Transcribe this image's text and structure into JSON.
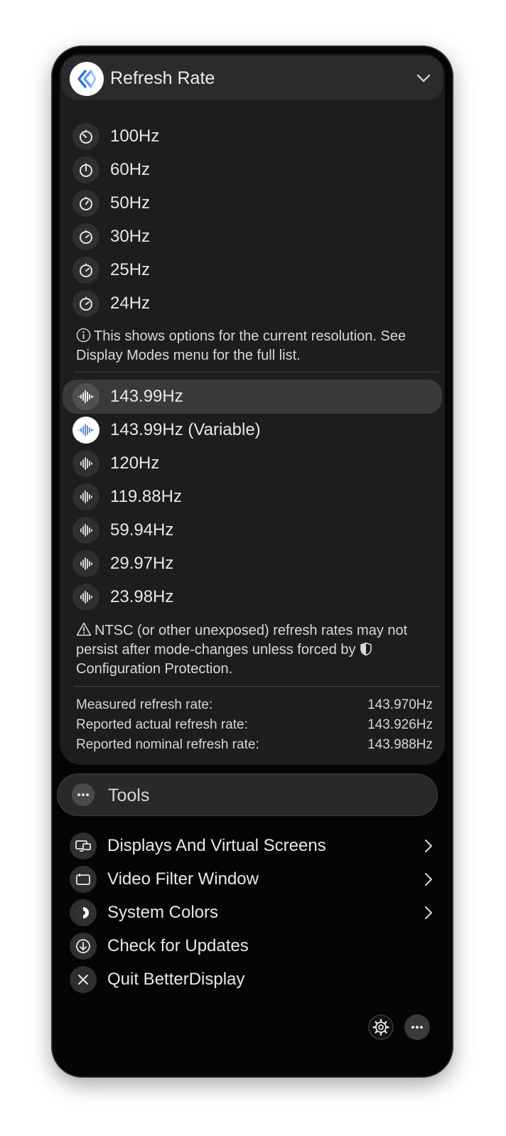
{
  "header": {
    "title": "Refresh Rate"
  },
  "rates_current": [
    {
      "label": "100Hz"
    },
    {
      "label": "60Hz"
    },
    {
      "label": "50Hz"
    },
    {
      "label": "30Hz"
    },
    {
      "label": "25Hz"
    },
    {
      "label": "24Hz"
    }
  ],
  "info_note": {
    "icon": "info-icon",
    "text": "This shows options for the current resolution. See Display Modes menu for the full list."
  },
  "rates_all": [
    {
      "label": "143.99Hz",
      "selected": true
    },
    {
      "label": "143.99Hz (Variable)",
      "active": true
    },
    {
      "label": "120Hz"
    },
    {
      "label": "119.88Hz"
    },
    {
      "label": "59.94Hz"
    },
    {
      "label": "29.97Hz"
    },
    {
      "label": "23.98Hz"
    }
  ],
  "warning_note": {
    "icon": "warning-icon",
    "text_a": "NTSC (or other unexposed) refresh rates may not persist after mode-changes unless forced by",
    "text_b": "Configuration Protection."
  },
  "stats": [
    {
      "label": "Measured refresh rate:",
      "value": "143.970Hz"
    },
    {
      "label": "Reported actual refresh rate:",
      "value": "143.926Hz"
    },
    {
      "label": "Reported nominal refresh rate:",
      "value": "143.988Hz"
    }
  ],
  "tools": {
    "label": "Tools"
  },
  "tool_items": [
    {
      "label": "Displays And Virtual Screens",
      "icon": "displays-icon",
      "submenu": true
    },
    {
      "label": "Video Filter Window",
      "icon": "window-icon",
      "submenu": true
    },
    {
      "label": "System Colors",
      "icon": "color-icon",
      "submenu": true
    },
    {
      "label": "Check for Updates",
      "icon": "download-icon",
      "submenu": false
    },
    {
      "label": "Quit BetterDisplay",
      "icon": "close-icon",
      "submenu": false
    }
  ],
  "colors": {
    "accent": "#3f86ea",
    "panel": "#050505",
    "section": "#1d1d1e"
  }
}
